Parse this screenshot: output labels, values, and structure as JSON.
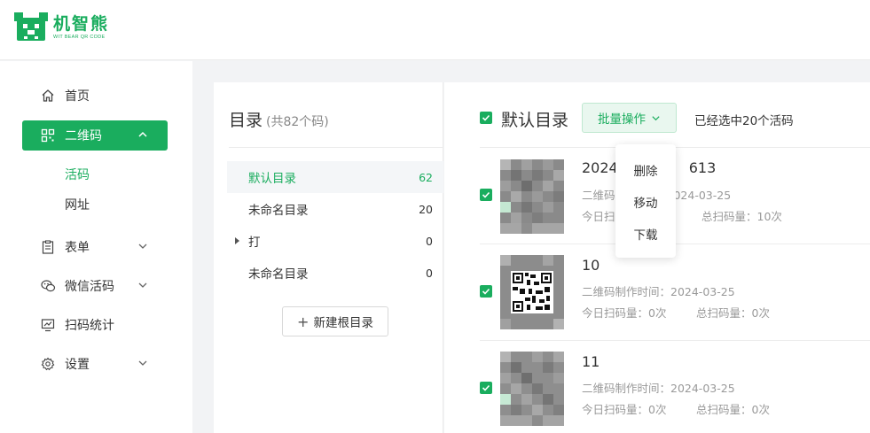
{
  "brand": {
    "name": "机智熊",
    "tagline": "WIT BEAR QR CODE",
    "color": "#1aad5e"
  },
  "sidebar": {
    "items": [
      {
        "label": "首页",
        "icon": "home-icon"
      },
      {
        "label": "二维码",
        "icon": "qrcode-icon",
        "active": true,
        "expanded": true
      },
      {
        "label": "表单",
        "icon": "form-icon"
      },
      {
        "label": "微信活码",
        "icon": "wechat-icon"
      },
      {
        "label": "扫码统计",
        "icon": "chart-icon"
      },
      {
        "label": "设置",
        "icon": "gear-icon"
      }
    ],
    "subitems": [
      {
        "label": "活码",
        "active": true
      },
      {
        "label": "网址"
      }
    ]
  },
  "directory": {
    "title": "目录",
    "count_text": "(共82个码)",
    "rows": [
      {
        "label": "默认目录",
        "count": "62",
        "active": true
      },
      {
        "label": "未命名目录",
        "count": "20"
      },
      {
        "label": "打",
        "count": "0",
        "has_children": true
      },
      {
        "label": "未命名目录",
        "count": "0"
      }
    ],
    "new_root_label": "新建根目录"
  },
  "main": {
    "title": "默认目录",
    "batch_label": "批量操作",
    "selected_text": "已经选中20个活码",
    "items": [
      {
        "name": "2024",
        "name_tail": "613",
        "created": "二维码制作时间：2024-03-25",
        "created_visible": "二维码",
        "created_tail": "2024-03-25",
        "today": "今日扫码量：0次",
        "today_visible": "今日扫",
        "total": "总扫码量：10次"
      },
      {
        "name": "10",
        "created": "二维码制作时间：2024-03-25",
        "today": "今日扫码量：0次",
        "total": "总扫码量：0次"
      },
      {
        "name": "11",
        "created": "二维码制作时间：2024-03-25",
        "today": "今日扫码量：0次",
        "total": "总扫码量：0次"
      }
    ]
  },
  "dropdown": {
    "items": [
      "删除",
      "移动",
      "下载"
    ]
  }
}
